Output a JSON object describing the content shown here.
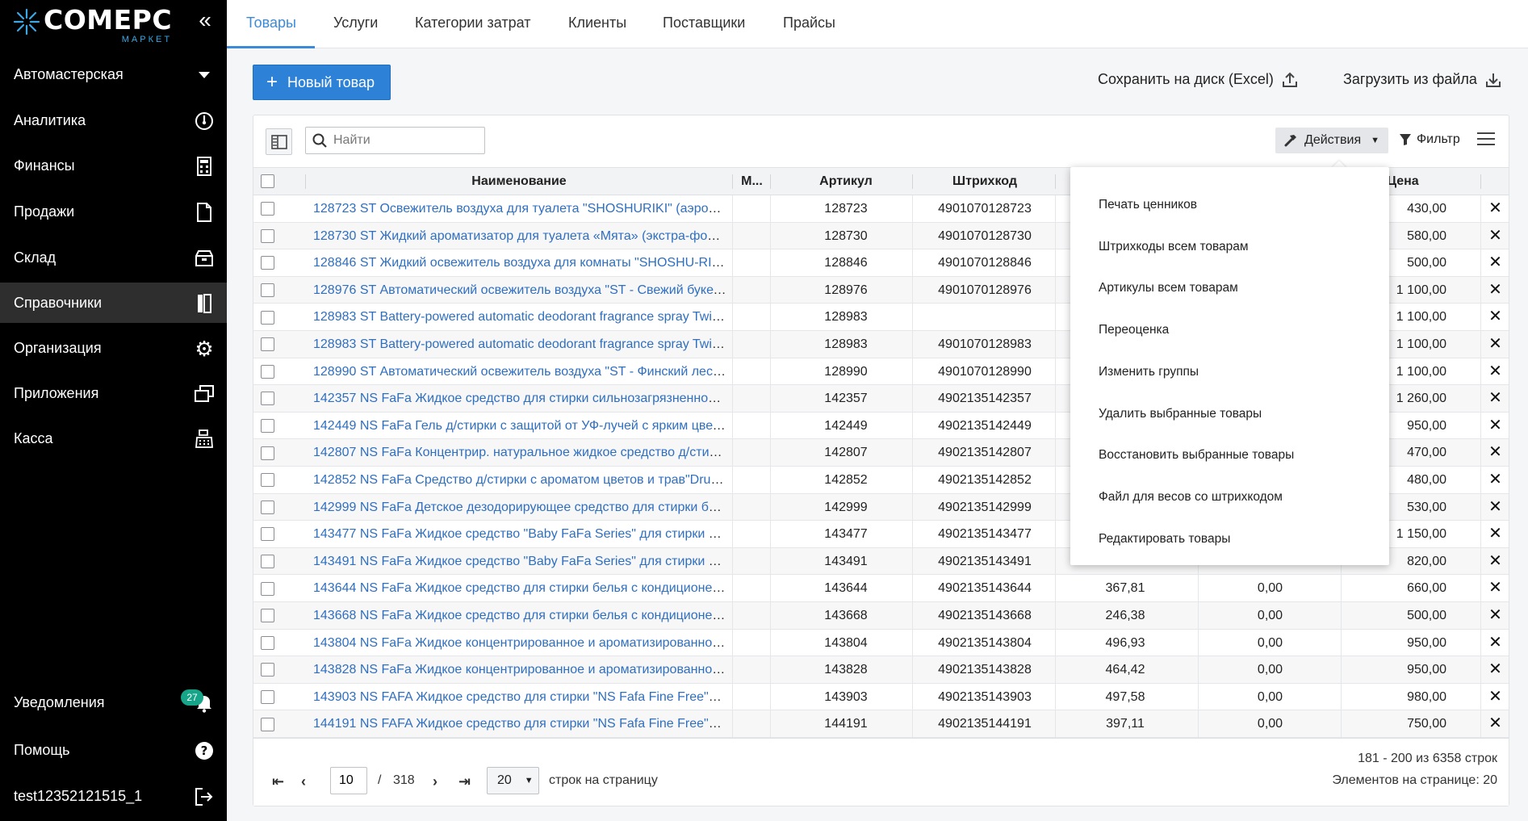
{
  "brand": {
    "name": "COMEPC",
    "sub": "МАРКЕТ",
    "accent": "#3aa7e6"
  },
  "sidebar": {
    "store": "Автомастерская",
    "items": [
      {
        "label": "Аналитика",
        "icon": "gauge-icon"
      },
      {
        "label": "Финансы",
        "icon": "calculator-icon"
      },
      {
        "label": "Продажи",
        "icon": "document-icon"
      },
      {
        "label": "Склад",
        "icon": "box-icon"
      },
      {
        "label": "Справочники",
        "icon": "book-icon",
        "active": true
      },
      {
        "label": "Организация",
        "icon": "gear-icon"
      },
      {
        "label": "Приложения",
        "icon": "windows-icon"
      },
      {
        "label": "Касса",
        "icon": "cash-register-icon"
      }
    ],
    "notifications": {
      "label": "Уведомления",
      "count": "27"
    },
    "help": "Помощь",
    "user": "test12352121515_1"
  },
  "tabs": [
    "Товары",
    "Услуги",
    "Категории затрат",
    "Клиенты",
    "Поставщики",
    "Прайсы"
  ],
  "toolbar": {
    "new_label": "Новый товар",
    "save_label": "Сохранить на диск (Excel)",
    "load_label": "Загрузить из файла",
    "search_placeholder": "Найти",
    "actions_label": "Действия",
    "filter_label": "Фильтр"
  },
  "columns": {
    "name": "Наименование",
    "m": "М...",
    "article": "Артикул",
    "barcode": "Штрихкод",
    "price": "Цена"
  },
  "rows": [
    {
      "name": "128723 ST Освежитель воздуха для туалета \"SHOSHURIKI\" (аэрозоль ...",
      "article": "128723",
      "barcode": "4901070128723",
      "cost": "",
      "stock": "",
      "price": "430,00"
    },
    {
      "name": "128730 ST Жидкий ароматизатор для туалета «Мята» (экстра-формул...",
      "article": "128730",
      "barcode": "4901070128730",
      "cost": "",
      "stock": "",
      "price": "580,00"
    },
    {
      "name": "128846 ST Жидкий освежитель воздуха для комнаты \"SHOSHU-RIKI\" (...",
      "article": "128846",
      "barcode": "4901070128846",
      "cost": "",
      "stock": "",
      "price": "500,00"
    },
    {
      "name": "128976 ST Автоматический освежитель воздуха \"ST - Свежий букет\" (...",
      "article": "128976",
      "barcode": "4901070128976",
      "cost": "",
      "stock": "",
      "price": "1 100,00"
    },
    {
      "name": "128983 ST Battery-powered automatic deodorant fragrance spray Twinkl...",
      "article": "128983",
      "barcode": "",
      "cost": "",
      "stock": "",
      "price": "1 100,00"
    },
    {
      "name": "128983 ST Battery-powered automatic deodorant fragrance spray Twinkl...",
      "article": "128983",
      "barcode": "4901070128983",
      "cost": "",
      "stock": "",
      "price": "1 100,00"
    },
    {
      "name": "128990 ST Автоматический освежитель воздуха \"ST - Финский лес\" (к...",
      "article": "128990",
      "barcode": "4901070128990",
      "cost": "",
      "stock": "",
      "price": "1 100,00"
    },
    {
      "name": "142357 NS FaFa Жидкое средство для стирки сильнозагрязненной од...",
      "article": "142357",
      "barcode": "4902135142357",
      "cost": "",
      "stock": "",
      "price": "1 260,00"
    },
    {
      "name": "142449 NS FaFa Гель д/стирки с защитой от УФ-лучей с ярким цветоч...",
      "article": "142449",
      "barcode": "4902135142449",
      "cost": "",
      "stock": "",
      "price": "950,00"
    },
    {
      "name": "142807 NS FaFa Концентрир. натуральное жидкое средство д/стирки ...",
      "article": "142807",
      "barcode": "4902135142807",
      "cost": "",
      "stock": "",
      "price": "470,00"
    },
    {
      "name": "142852 NS FaFa Средство д/стирки с ароматом цветов и трав\"Drum-t...",
      "article": "142852",
      "barcode": "4902135142852",
      "cost": "",
      "stock": "",
      "price": "480,00"
    },
    {
      "name": "142999 NS FaFa Детское дезодорирующее средство для стирки белья...",
      "article": "142999",
      "barcode": "4902135142999",
      "cost": "",
      "stock": "",
      "price": "530,00"
    },
    {
      "name": "143477 NS FaFa Жидкое средство \"Baby FaFa Series\" для стирки детск...",
      "article": "143477",
      "barcode": "4902135143477",
      "cost": "",
      "stock": "",
      "price": "1 150,00"
    },
    {
      "name": "143491 NS FaFa Жидкое средство \"Baby FaFa Series\" для стирки детск...",
      "article": "143491",
      "barcode": "4902135143491",
      "cost": "",
      "stock": "",
      "price": "820,00"
    },
    {
      "name": "143644 NS FaFa Жидкое средство для стирки белья с кондиционером...",
      "article": "143644",
      "barcode": "4902135143644",
      "cost": "367,81",
      "stock": "0,00",
      "price": "660,00"
    },
    {
      "name": "143668 NS FaFa Жидкое средство для стирки белья с кондиционером...",
      "article": "143668",
      "barcode": "4902135143668",
      "cost": "246,38",
      "stock": "0,00",
      "price": "500,00"
    },
    {
      "name": "143804 NS FaFa Жидкое концентрированное и ароматизированное с...",
      "article": "143804",
      "barcode": "4902135143804",
      "cost": "496,93",
      "stock": "0,00",
      "price": "950,00"
    },
    {
      "name": "143828 NS FaFa Жидкое концентрированное и ароматизированное с...",
      "article": "143828",
      "barcode": "4902135143828",
      "cost": "464,42",
      "stock": "0,00",
      "price": "950,00"
    },
    {
      "name": "143903 NS FAFA Жидкое средство для стирки \"NS Fafa Fine Free\"от не...",
      "article": "143903",
      "barcode": "4902135143903",
      "cost": "497,58",
      "stock": "0,00",
      "price": "980,00"
    },
    {
      "name": "144191 NS FAFA Жидкое средство для стирки \"NS Fafa Fine Free\"от не...",
      "article": "144191",
      "barcode": "4902135144191",
      "cost": "397,11",
      "stock": "0,00",
      "price": "750,00"
    }
  ],
  "actions_menu": [
    "Печать ценников",
    "Штрихкоды всем товарам",
    "Артикулы всем товарам",
    "Переоценка",
    "Изменить группы",
    "Удалить выбранные товары",
    "Восстановить выбранные товары",
    "Файл для весов со штрихкодом",
    "Редактировать товары"
  ],
  "pagination": {
    "page": "10",
    "separator": "/",
    "total_pages": "318",
    "per_page": "20",
    "per_page_label": "строк на страницу",
    "range_text": "181 - 200 из 6358 строк",
    "elements_text": "Элементов на странице: 20"
  }
}
